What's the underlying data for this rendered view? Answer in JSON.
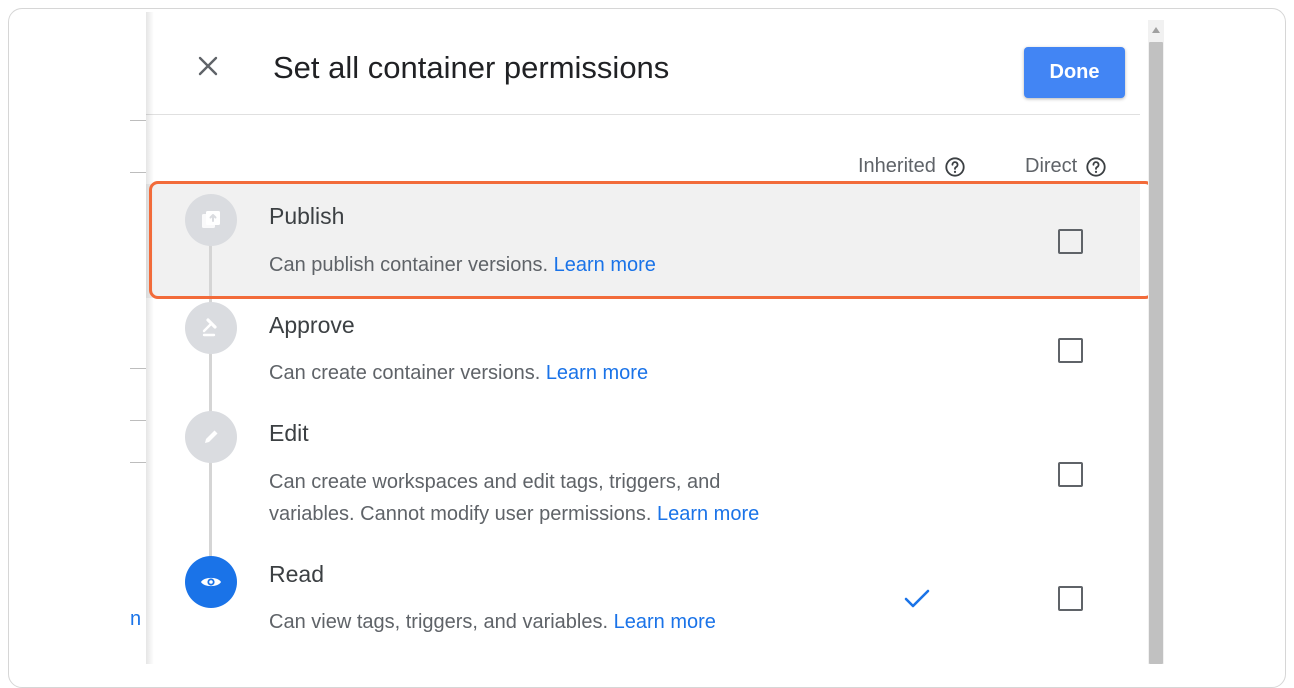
{
  "dialog": {
    "title": "Set all container permissions",
    "done_label": "Done"
  },
  "columns": {
    "inherited": "Inherited",
    "direct": "Direct"
  },
  "roles": [
    {
      "name": "Publish",
      "desc": "Can publish container versions.",
      "learn": "Learn more",
      "icon": "publish-icon",
      "inherited": false,
      "direct": false
    },
    {
      "name": "Approve",
      "desc": "Can create container versions.",
      "learn": "Learn more",
      "icon": "gavel-icon",
      "inherited": false,
      "direct": false
    },
    {
      "name": "Edit",
      "desc_line1": "Can create workspaces and edit tags, triggers, and",
      "desc_line2": "variables. Cannot modify user permissions.",
      "learn": "Learn more",
      "icon": "pencil-icon",
      "inherited": false,
      "direct": false
    },
    {
      "name": "Read",
      "desc": "Can view tags, triggers, and variables.",
      "learn": "Learn more",
      "icon": "eye-icon",
      "inherited": true,
      "direct": false
    }
  ],
  "background": {
    "glyph": "n"
  },
  "colors": {
    "accent": "#1a73e8",
    "done_button": "#4285f4",
    "highlight_border": "#f26b3a"
  }
}
